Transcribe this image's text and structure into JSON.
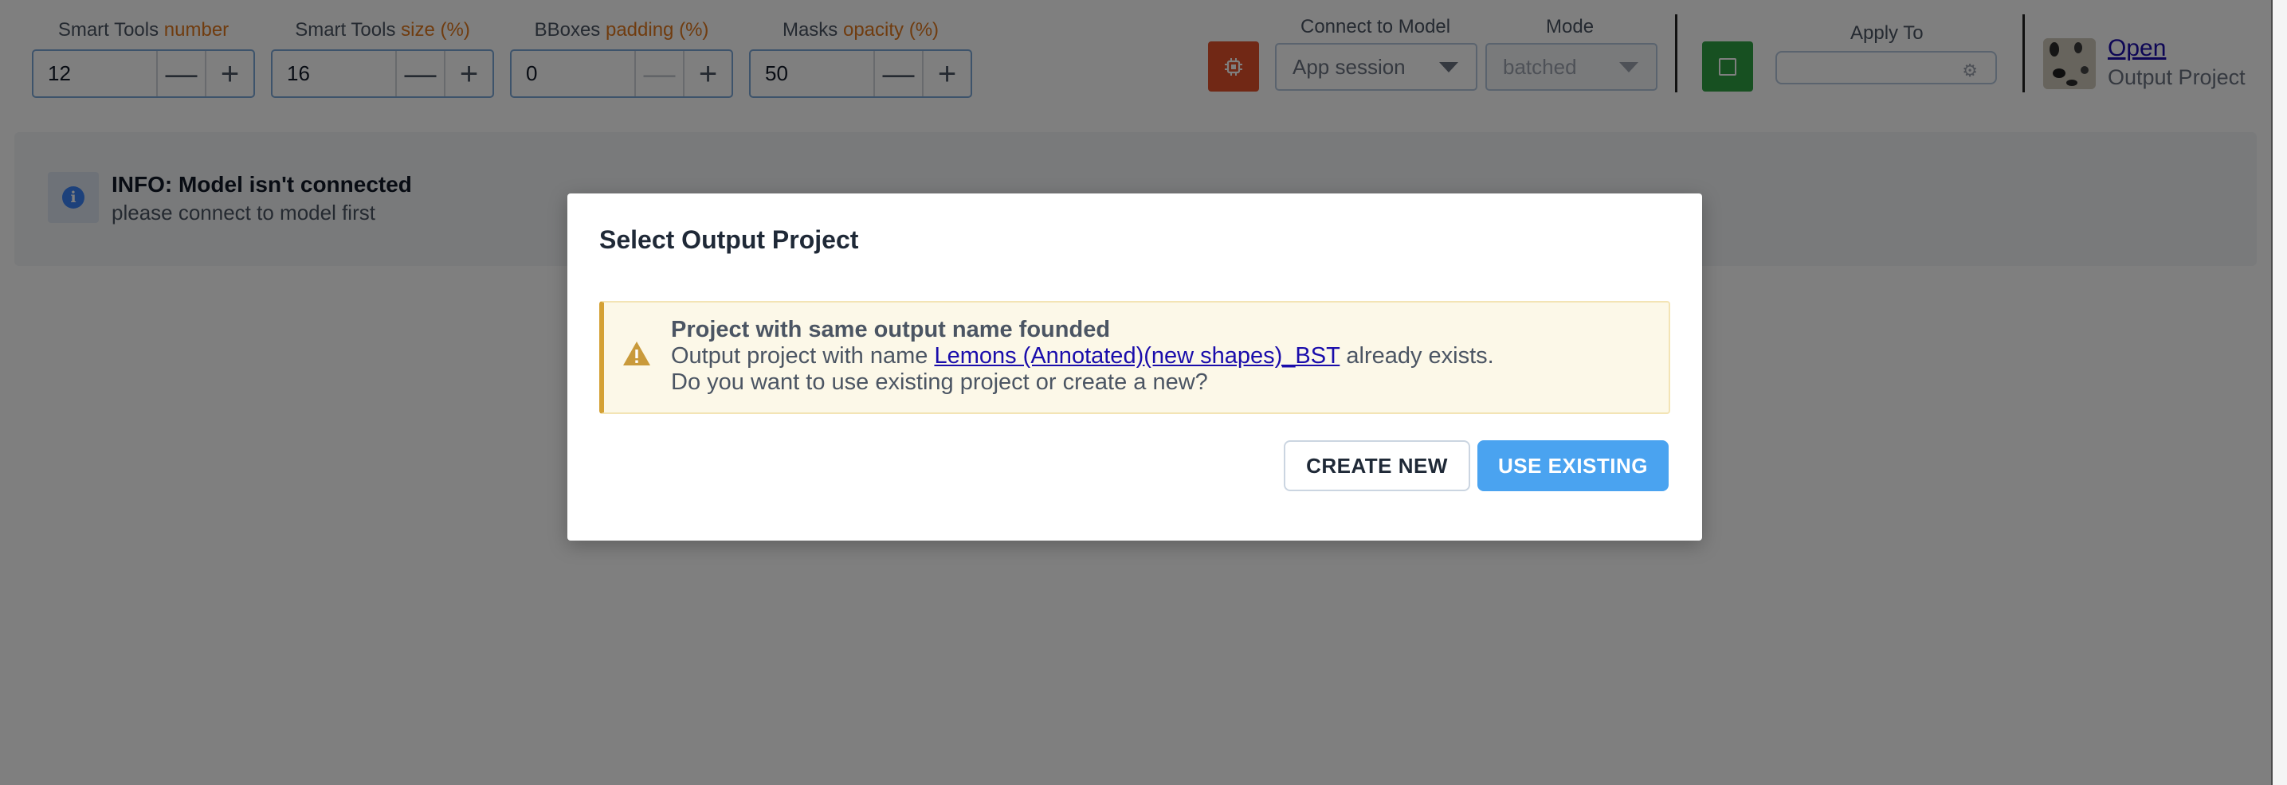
{
  "toolbar": {
    "smart_tools_number": {
      "label_main": "Smart Tools",
      "label_hl": "number",
      "value": "12"
    },
    "smart_tools_size": {
      "label_main": "Smart Tools",
      "label_hl": "size (%)",
      "value": "16"
    },
    "bboxes_padding": {
      "label_main": "BBoxes",
      "label_hl": "padding (%)",
      "value": "0"
    },
    "masks_opacity": {
      "label_main": "Masks",
      "label_hl": "opacity (%)",
      "value": "50"
    },
    "minus_glyph": "—",
    "plus_glyph": "+",
    "connect_label": "Connect to Model",
    "connect_value": "App session",
    "mode_label": "Mode",
    "mode_value": "batched",
    "apply_label": "Apply To",
    "open_link": "Open",
    "open_sub": "Output Project"
  },
  "info": {
    "title": "INFO: Model isn't connected",
    "message": "please connect to model first",
    "icon_glyph": "i"
  },
  "modal": {
    "title": "Select Output Project",
    "warning_title": "Project with same output name founded",
    "line1_prefix": "Output project with name",
    "project_name": "Lemons (Annotated)(new shapes)_BST",
    "line1_suffix": "already exists.",
    "line2": "Do you want to use existing project or create a new?",
    "create_new": "CREATE NEW",
    "use_existing": "USE EXISTING"
  },
  "colors": {
    "accent_orange": "#e1781e",
    "chip_red": "#e2502a",
    "stop_green": "#2ea043",
    "primary_blue": "#4aa3f0",
    "warning_border": "#d4a135"
  },
  "icons": [
    "chip-icon",
    "stop-icon",
    "gear-icon",
    "info-icon",
    "warning-icon"
  ]
}
